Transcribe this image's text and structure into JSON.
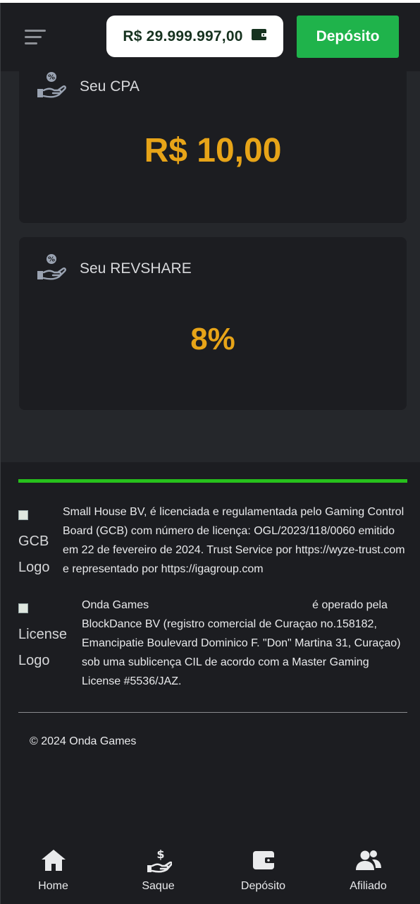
{
  "header": {
    "balance": "R$ 29.999.997,00",
    "deposit_label": "Depósito"
  },
  "cards": [
    {
      "title": "Seu CPA",
      "value": "R$ 10,00"
    },
    {
      "title": "Seu REVSHARE",
      "value": "8%"
    }
  ],
  "footer": {
    "gcb_logo_alt": "GCB Logo",
    "gcb_text": "Small House BV, é licenciada e regulamentada pelo Gaming Control Board (GCB) com número de licença: OGL/2023/118/0060 emitido em 22 de fevereiro de 2024. Trust Service por https://wyze-trust.com e representado por https://igagroup.com",
    "license_logo_alt": "License Logo",
    "license_brand": "Onda Games",
    "license_text": "é operado pela BlockDance BV (registro comercial de Curaçao no.158182, Emancipatie Boulevard Dominico F. \"Don\" Martina 31, Curaçao) sob uma sublicença CIL de acordo com a Master Gaming License #5536/JAZ.",
    "copyright": "© 2024 Onda Games"
  },
  "bottom_nav": [
    {
      "label": "Home",
      "icon": "home-icon"
    },
    {
      "label": "Saque",
      "icon": "hand-dollar-icon"
    },
    {
      "label": "Depósito",
      "icon": "wallet-icon"
    },
    {
      "label": "Afiliado",
      "icon": "users-icon"
    }
  ],
  "colors": {
    "background": "#25272b",
    "surface": "#1c1d21",
    "accent_green": "#1fb34b",
    "value_gold": "#e7a418",
    "divider_green": "#27c01c"
  }
}
